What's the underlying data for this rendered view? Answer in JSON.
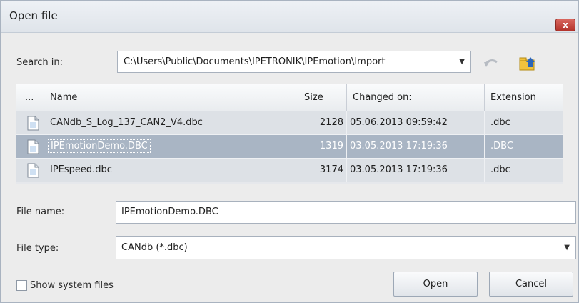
{
  "window": {
    "title": "Open file",
    "close_glyph": "x"
  },
  "search": {
    "label": "Search in:",
    "path": "C:\\Users\\Public\\Documents\\IPETRONIK\\IPEmotion\\Import",
    "back_icon": "back-arrow-icon",
    "up_icon": "folder-up-icon"
  },
  "grid": {
    "columns": {
      "ellipsis": "...",
      "name": "Name",
      "size": "Size",
      "changed": "Changed on:",
      "extension": "Extension"
    },
    "rows": [
      {
        "name": "CANdb_S_Log_137_CAN2_V4.dbc",
        "size": "2128",
        "changed": "05.06.2013 09:59:42",
        "extension": ".dbc",
        "selected": false
      },
      {
        "name": "IPEmotionDemo.DBC",
        "size": "1319",
        "changed": "03.05.2013 17:19:36",
        "extension": ".DBC",
        "selected": true
      },
      {
        "name": "IPEspeed.dbc",
        "size": "3174",
        "changed": "03.05.2013 17:19:36",
        "extension": ".dbc",
        "selected": false
      }
    ]
  },
  "filename": {
    "label": "File name:",
    "value": "IPEmotionDemo.DBC"
  },
  "filetype": {
    "label": "File type:",
    "value": "CANdb (*.dbc)"
  },
  "options": {
    "show_system_files": "Show system files",
    "show_system_files_checked": false
  },
  "buttons": {
    "open": "Open",
    "cancel": "Cancel"
  },
  "colors": {
    "selected_row": "#a9b5c4",
    "close_button": "#c0392b"
  }
}
